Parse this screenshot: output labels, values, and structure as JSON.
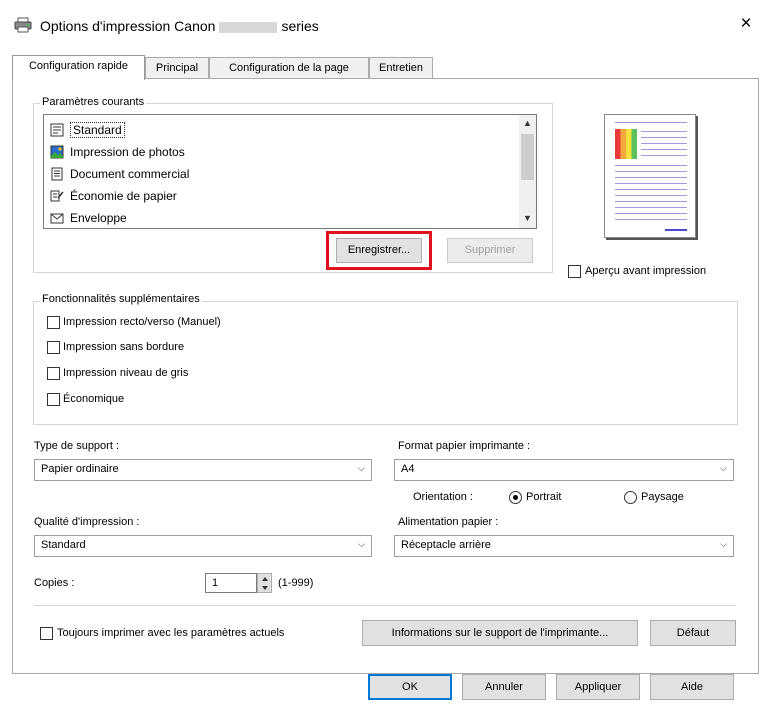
{
  "window": {
    "title_prefix": "Options d'impression Canon",
    "title_suffix": "series",
    "close_glyph": "×"
  },
  "tabs": [
    {
      "label": "Configuration rapide",
      "active": true
    },
    {
      "label": "Principal",
      "active": false
    },
    {
      "label": "Configuration de la page",
      "active": false
    },
    {
      "label": "Entretien",
      "active": false
    }
  ],
  "current_settings": {
    "group_label": "Paramètres courants",
    "items": [
      {
        "label": "Standard",
        "icon": "document-standard-icon",
        "selected": true
      },
      {
        "label": "Impression de photos",
        "icon": "photo-icon",
        "selected": false
      },
      {
        "label": "Document commercial",
        "icon": "business-document-icon",
        "selected": false
      },
      {
        "label": "Économie de papier",
        "icon": "paper-saving-icon",
        "selected": false
      },
      {
        "label": "Enveloppe",
        "icon": "envelope-icon",
        "selected": false
      }
    ],
    "save_button": "Enregistrer...",
    "delete_button": "Supprimer"
  },
  "preview": {
    "checkbox_label": "Aperçu avant impression",
    "checked": false
  },
  "additional_features": {
    "group_label": "Fonctionnalités supplémentaires",
    "options": [
      {
        "label": "Impression recto/verso (Manuel)",
        "checked": false
      },
      {
        "label": "Impression sans bordure",
        "checked": false
      },
      {
        "label": "Impression niveau de gris",
        "checked": false
      },
      {
        "label": "Économique",
        "checked": false
      }
    ]
  },
  "media_type": {
    "label": "Type de support :",
    "value": "Papier ordinaire"
  },
  "printer_paper_size": {
    "label": "Format papier imprimante :",
    "value": "A4"
  },
  "orientation": {
    "label": "Orientation :",
    "portrait": "Portrait",
    "landscape": "Paysage",
    "selected": "Portrait"
  },
  "print_quality": {
    "label": "Qualité d'impression :",
    "value": "Standard"
  },
  "paper_source": {
    "label": "Alimentation papier :",
    "value": "Réceptacle arrière"
  },
  "copies": {
    "label": "Copies :",
    "value": "1",
    "range": "(1-999)"
  },
  "bottom": {
    "always_print_label": "Toujours imprimer avec les paramètres actuels",
    "always_print_checked": false,
    "info_button": "Informations sur le support de l'imprimante...",
    "default_button": "Défaut"
  },
  "dialog_buttons": {
    "ok": "OK",
    "cancel": "Annuler",
    "apply": "Appliquer",
    "help": "Aide"
  },
  "colors": {
    "accent": "#0078d7",
    "highlight_outline": "#e0101e"
  }
}
